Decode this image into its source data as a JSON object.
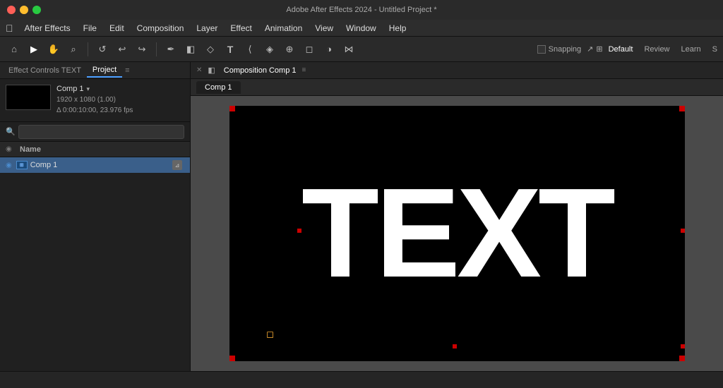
{
  "titleBar": {
    "title": "Adobe After Effects 2024 - Untitled Project *",
    "trafficLights": [
      "red",
      "yellow",
      "green"
    ]
  },
  "menuBar": {
    "appleLabel": "",
    "items": [
      "After Effects",
      "File",
      "Edit",
      "Composition",
      "Layer",
      "Effect",
      "Animation",
      "View",
      "Window",
      "Help"
    ]
  },
  "toolbar": {
    "tools": [
      {
        "name": "home-icon",
        "symbol": "⌂"
      },
      {
        "name": "selection-tool-icon",
        "symbol": "▶"
      },
      {
        "name": "hand-tool-icon",
        "symbol": "✋"
      },
      {
        "name": "zoom-tool-icon",
        "symbol": "🔍"
      },
      {
        "name": "rotate-tool-icon",
        "symbol": "↺"
      },
      {
        "name": "undo-icon",
        "symbol": "↩"
      },
      {
        "name": "redo-icon",
        "symbol": "↪"
      },
      {
        "name": "pen-tool-icon",
        "symbol": "✒"
      },
      {
        "name": "mask-tool-icon",
        "symbol": "□"
      },
      {
        "name": "clone-tool-icon",
        "symbol": "⊕"
      },
      {
        "name": "text-tool-icon",
        "symbol": "T"
      },
      {
        "name": "shape-tool-icon",
        "symbol": "◇"
      },
      {
        "name": "pin-tool-icon",
        "symbol": "◻"
      },
      {
        "name": "paint-tool-icon",
        "symbol": "🖌"
      },
      {
        "name": "motion-tool-icon",
        "symbol": "◈"
      }
    ],
    "snapping": {
      "label": "Snapping",
      "enabled": false
    },
    "workspaces": [
      "Default",
      "Review",
      "Learn",
      "S"
    ]
  },
  "leftPanel": {
    "tabs": [
      {
        "label": "Effect Controls TEXT",
        "active": false
      },
      {
        "label": "Project",
        "active": true
      }
    ],
    "compInfo": {
      "name": "Comp 1",
      "resolution": "1920 x 1080 (1.00)",
      "duration": "Δ 0:00:10:00, 23.976 fps"
    },
    "searchPlaceholder": "🔍",
    "columns": {
      "nameLabel": "Name"
    },
    "items": [
      {
        "name": "Comp 1",
        "type": "composition",
        "icon": "comp-icon"
      }
    ]
  },
  "viewer": {
    "tabLabel": "Composition Comp 1",
    "menuIcon": "≡",
    "compTab": "Comp 1",
    "canvasText": "TEXT"
  },
  "statusBar": {
    "text": ""
  }
}
